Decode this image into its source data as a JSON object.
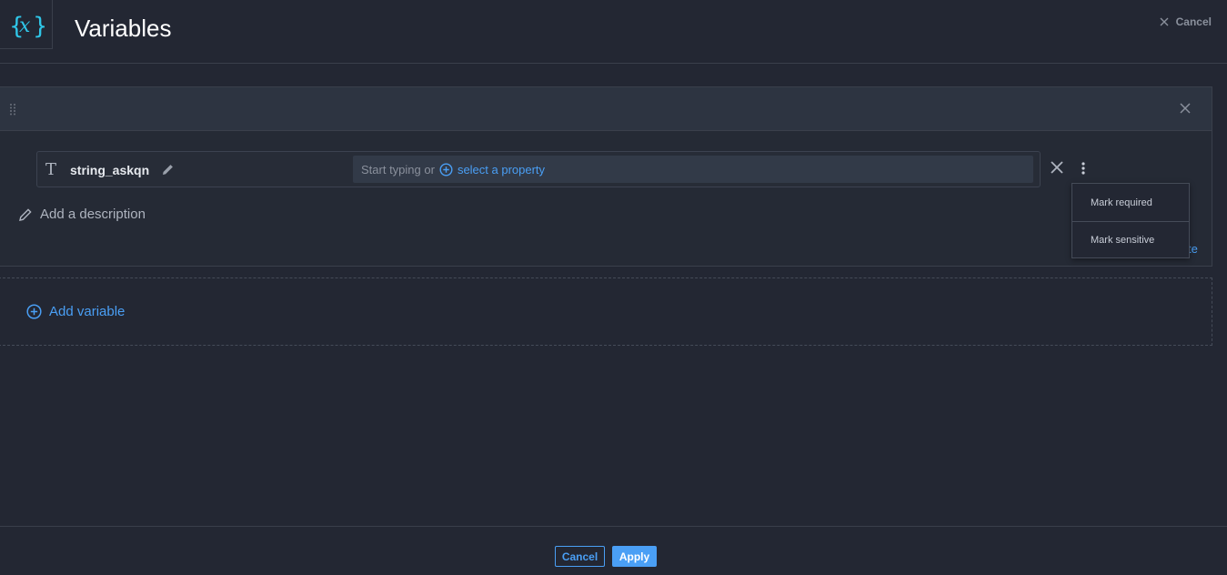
{
  "header": {
    "icon": "curly-x-icon",
    "title": "Variables",
    "cancel_label": "Cancel"
  },
  "variable": {
    "type_glyph": "T",
    "name": "string_askqn",
    "value_placeholder": "Start typing or",
    "select_property_label": "select a property",
    "add_description_label": "Add a description",
    "partially_hidden_link": "te"
  },
  "row_menu": {
    "items": [
      "Mark required",
      "Mark sensitive"
    ]
  },
  "add_variable_label": "Add variable",
  "footer": {
    "cancel_label": "Cancel",
    "apply_label": "Apply"
  },
  "colors": {
    "background": "#232733",
    "accent": "#4a9ff5",
    "icon_cyan": "#2fc6e8"
  }
}
